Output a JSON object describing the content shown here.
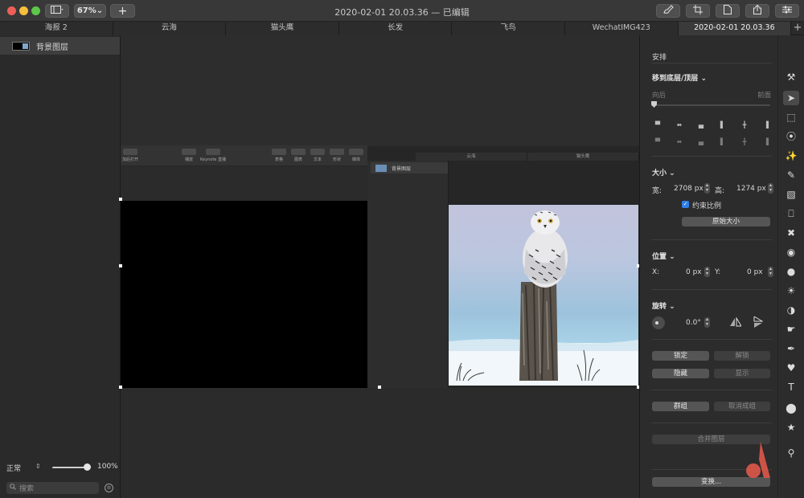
{
  "window": {
    "title": "2020-02-01 20.03.36 — 已编辑",
    "zoom": "67%",
    "add_label": "+"
  },
  "tabs": [
    "海报 2",
    "云海",
    "猫头鹰",
    "长发",
    "飞鸟",
    "WechatIMG423",
    "2020-02-01 20.03.36"
  ],
  "tab_add": "+",
  "layers": {
    "item_label": "背景图层",
    "blend_mode": "正常",
    "opacity": "100%",
    "search_placeholder": "搜索"
  },
  "inner_toolbar": {
    "items": [
      "加后打开",
      "播放",
      "Keynote 直播",
      "表格",
      "图表",
      "文本",
      "形状",
      "媒体"
    ]
  },
  "sub_window": {
    "tabs": [
      "云海",
      "猫头鹰"
    ],
    "layer_label": "背景图层"
  },
  "arrange": {
    "section": "安排",
    "move_label": "移到底层/顶层",
    "back_label": "向后",
    "front_label": "前面"
  },
  "size": {
    "section": "大小",
    "width_label": "宽:",
    "width_value": "2708 px",
    "height_label": "高:",
    "height_value": "1274 px",
    "constrain_label": "约束比例",
    "original_label": "原始大小"
  },
  "position": {
    "section": "位置",
    "x_label": "X:",
    "x_value": "0 px",
    "y_label": "Y:",
    "y_value": "0 px"
  },
  "rotate": {
    "section": "旋转",
    "value": "0.0°"
  },
  "actions": {
    "lock": "锁定",
    "unlock": "解锁",
    "hide": "隐藏",
    "show": "显示",
    "group": "群组",
    "ungroup": "取消成组",
    "merge": "合并图层",
    "transform": "变换..."
  },
  "colors": {
    "accent": "#e0584a",
    "checkbox": "#2f7ee8",
    "panel": "#2c2c2c"
  }
}
